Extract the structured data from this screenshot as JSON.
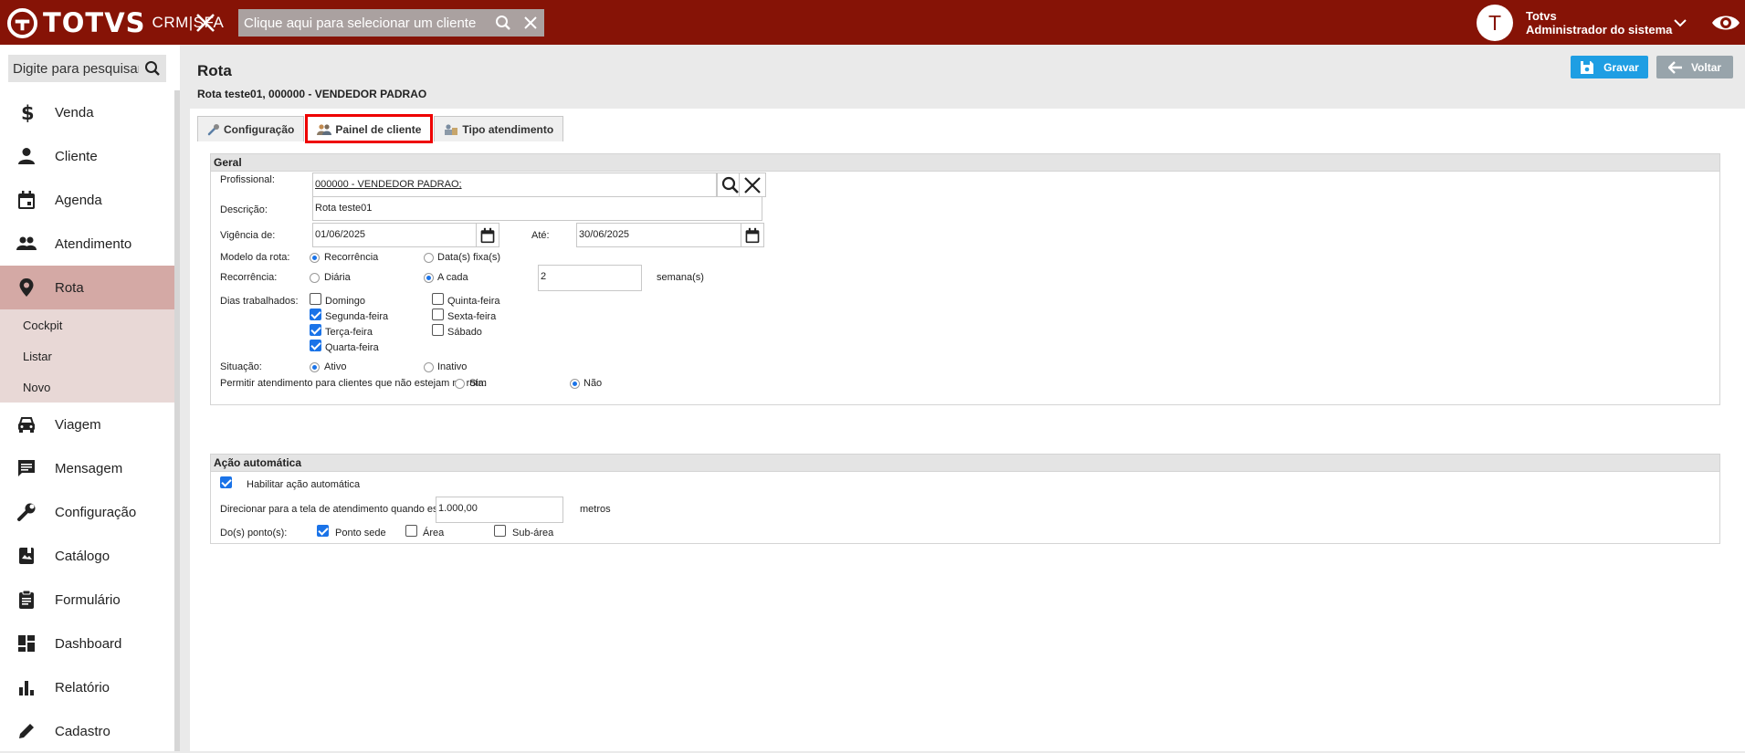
{
  "header": {
    "brand": "TOTVS",
    "product": "CRM|SFA",
    "client_search_placeholder": "Clique aqui para selecionar um cliente",
    "user_initial": "T",
    "user_name": "Totvs",
    "user_role": "Administrador do sistema",
    "bg_color": "#861306"
  },
  "sidebar": {
    "search_placeholder": "Digite para pesquisar...",
    "items": [
      {
        "label": "Venda",
        "icon": "dollar-icon"
      },
      {
        "label": "Cliente",
        "icon": "person-icon"
      },
      {
        "label": "Agenda",
        "icon": "calendar-icon"
      },
      {
        "label": "Atendimento",
        "icon": "people-icon"
      },
      {
        "label": "Rota",
        "icon": "map-pin-icon",
        "active": true
      },
      {
        "label": "Viagem",
        "icon": "car-icon"
      },
      {
        "label": "Mensagem",
        "icon": "message-icon"
      },
      {
        "label": "Configuração",
        "icon": "wrench-icon"
      },
      {
        "label": "Catálogo",
        "icon": "book-icon"
      },
      {
        "label": "Formulário",
        "icon": "clipboard-icon"
      },
      {
        "label": "Dashboard",
        "icon": "dashboard-icon"
      },
      {
        "label": "Relatório",
        "icon": "bar-chart-icon"
      },
      {
        "label": "Cadastro",
        "icon": "pencil-icon"
      }
    ],
    "submenu": [
      "Cockpit",
      "Listar",
      "Novo"
    ]
  },
  "page": {
    "title": "Rota",
    "subtitle": "Rota teste01, 000000 - VENDEDOR PADRAO",
    "save_label": "Gravar",
    "back_label": "Voltar"
  },
  "tabs": [
    "Configuração",
    "Painel de cliente",
    "Tipo atendimento"
  ],
  "geral": {
    "title": "Geral",
    "profissional_label": "Profissional:",
    "profissional_value": "000000 - VENDEDOR PADRAO;",
    "descricao_label": "Descrição:",
    "descricao_value": "Rota teste01",
    "vigencia_label": "Vigência de:",
    "vigencia_value": "01/06/2025",
    "ate_label": "Até:",
    "ate_value": "30/06/2025",
    "modelo_label": "Modelo da rota:",
    "modelo_opt1": "Recorrência",
    "modelo_opt2": "Data(s) fixa(s)",
    "recorrencia_label": "Recorrência:",
    "rec_opt1": "Diária",
    "rec_opt2": "A cada",
    "rec_value": "2",
    "rec_unit": "semana(s)",
    "dias_label": "Dias trabalhados:",
    "dias": {
      "domingo": "Domingo",
      "segunda": "Segunda-feira",
      "terca": "Terça-feira",
      "quarta": "Quarta-feira",
      "quinta": "Quinta-feira",
      "sexta": "Sexta-feira",
      "sabado": "Sábado"
    },
    "situacao_label": "Situação:",
    "sit_opt1": "Ativo",
    "sit_opt2": "Inativo",
    "permitir_label": "Permitir atendimento para clientes que não estejam na rota:",
    "perm_opt1": "Sim",
    "perm_opt2": "Não"
  },
  "acao": {
    "title": "Ação automática",
    "habilitar_label": "Habilitar ação automática",
    "direcionar_label": "Direcionar para a tela de atendimento quando estiver à:",
    "distance_value": "1.000,00",
    "distance_unit": "metros",
    "pontos_label": "Do(s) ponto(s):",
    "ponto_sede": "Ponto sede",
    "area": "Área",
    "subarea": "Sub-área"
  }
}
